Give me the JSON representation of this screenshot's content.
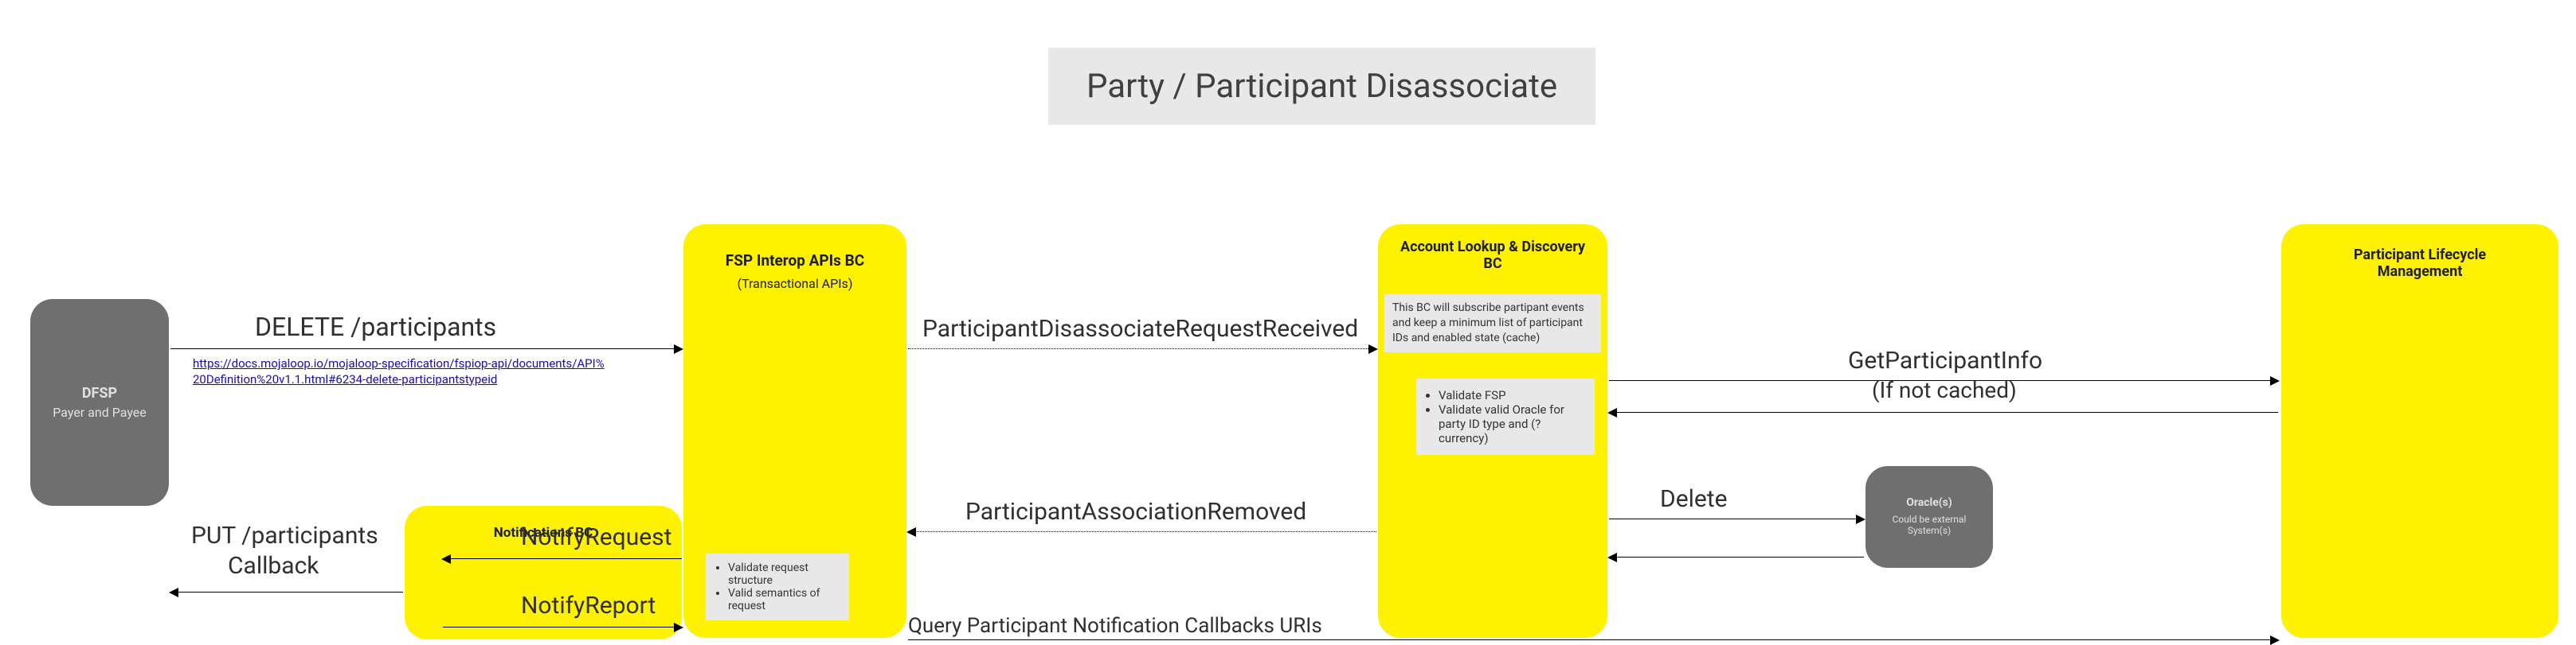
{
  "title": "Party / Participant Disassociate",
  "nodes": {
    "dfsp": {
      "title": "DFSP",
      "subtitle": "Payer and Payee"
    },
    "notifications": {
      "title": "Notifications BC"
    },
    "fsp_interop": {
      "title": "FSP Interop APIs BC",
      "subtitle": "(Transactional APIs)",
      "note_items": [
        "Validate request structure",
        "Valid semantics of request"
      ]
    },
    "account_lookup": {
      "title": "Account Lookup & Discovery BC",
      "note_text": "This BC will subscribe partipant events and keep a minimum list of participant IDs and enabled state (cache)",
      "note_items": [
        "Validate FSP",
        "Validate valid Oracle for party ID type and (?currency)"
      ]
    },
    "oracles": {
      "title": "Oracle(s)",
      "subtitle": "Could be external System(s)"
    },
    "plm": {
      "title": "Participant Lifecycle Management"
    }
  },
  "arrows": {
    "delete_participants": "DELETE /participants",
    "link_url": "https://docs.mojaloop.io/mojaloop-specification/fspiop-api/documents/API%20Definition%20v1.1.html#6234-delete-participantstypeid",
    "req_received": "ParticipantDisassociateRequestReceived",
    "get_participant_info": "GetParticipantInfo",
    "get_participant_info_sub": "(If not cached)",
    "assoc_removed": "ParticipantAssociationRemoved",
    "delete": "Delete",
    "notify_request": "NotifyRequest",
    "notify_report": "NotifyReport",
    "put_callback_1": "PUT /participants",
    "put_callback_2": "Callback",
    "query_callbacks": "Query Participant Notification Callbacks URIs"
  }
}
